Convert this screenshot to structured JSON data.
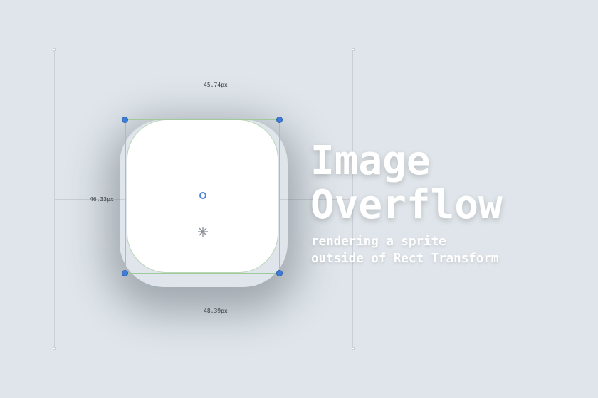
{
  "scene": {
    "title_line1": "Image",
    "title_line2": "Overflow",
    "subtitle_line1": "rendering a sprite",
    "subtitle_line2": "outside of Rect Transform"
  },
  "measurements": {
    "top": "45,74px",
    "left": "46,33px",
    "bottom": "48,39px"
  },
  "colors": {
    "background": "#dfe5ea",
    "sprite": "#ffffff",
    "handle": "#3f7cd6",
    "rect_outline": "#9fca99",
    "guide": "#c8cfd5"
  },
  "icons": {
    "pivot": "pivot-circle-icon",
    "anchor": "anchor-star-icon"
  }
}
